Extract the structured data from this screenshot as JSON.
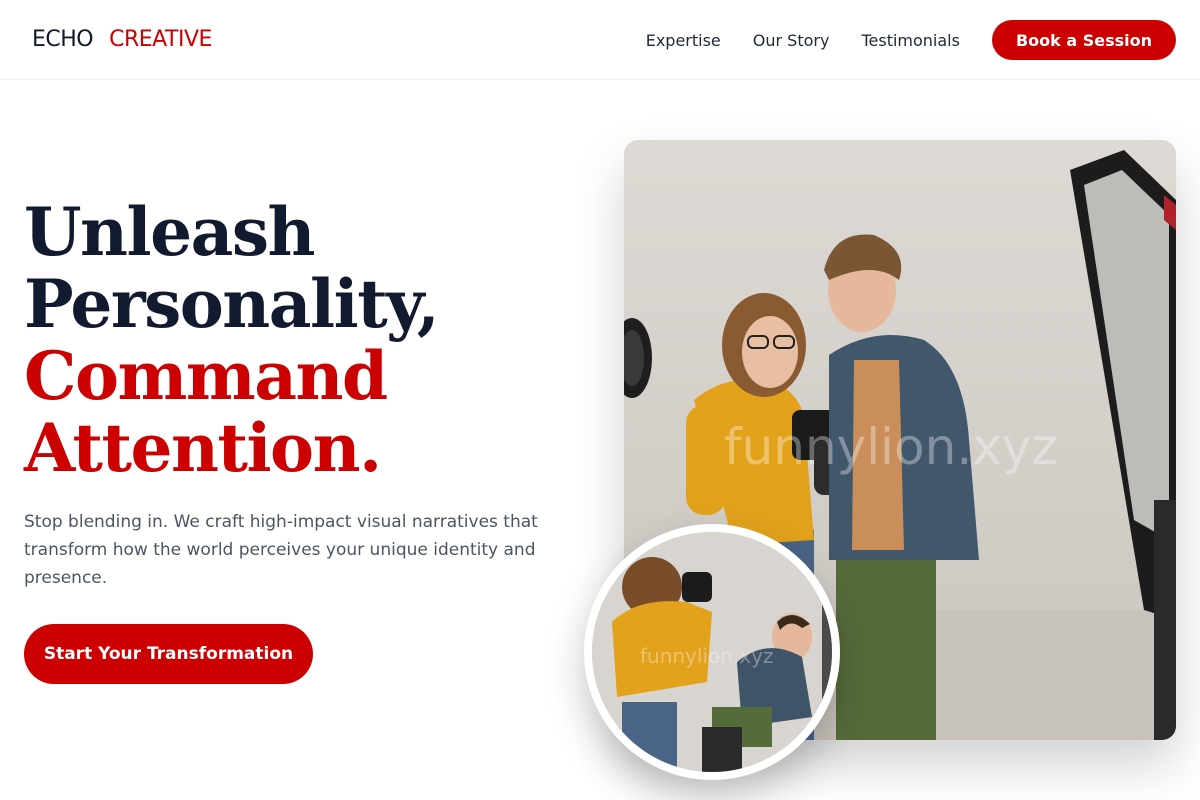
{
  "brand": {
    "word1": "ECHO",
    "word2": "CREATIVE"
  },
  "nav": {
    "links": [
      "Expertise",
      "Our Story",
      "Testimonials"
    ],
    "cta": "Book a Session"
  },
  "hero": {
    "headline_dark": [
      "Unleash",
      "Personality,"
    ],
    "headline_red": [
      "Command",
      "Attention."
    ],
    "subtext": "Stop blending in. We craft high-impact visual narratives that transform how the world perceives your unique identity and presence.",
    "cta": "Start Your Transformation"
  },
  "images": {
    "main": {
      "watermark": "funnylion.xyz"
    },
    "inset": {
      "watermark": "funnylion.xyz"
    }
  },
  "colors": {
    "accent": "#cc0000",
    "heading": "#111a2e",
    "body": "#4b5563"
  }
}
